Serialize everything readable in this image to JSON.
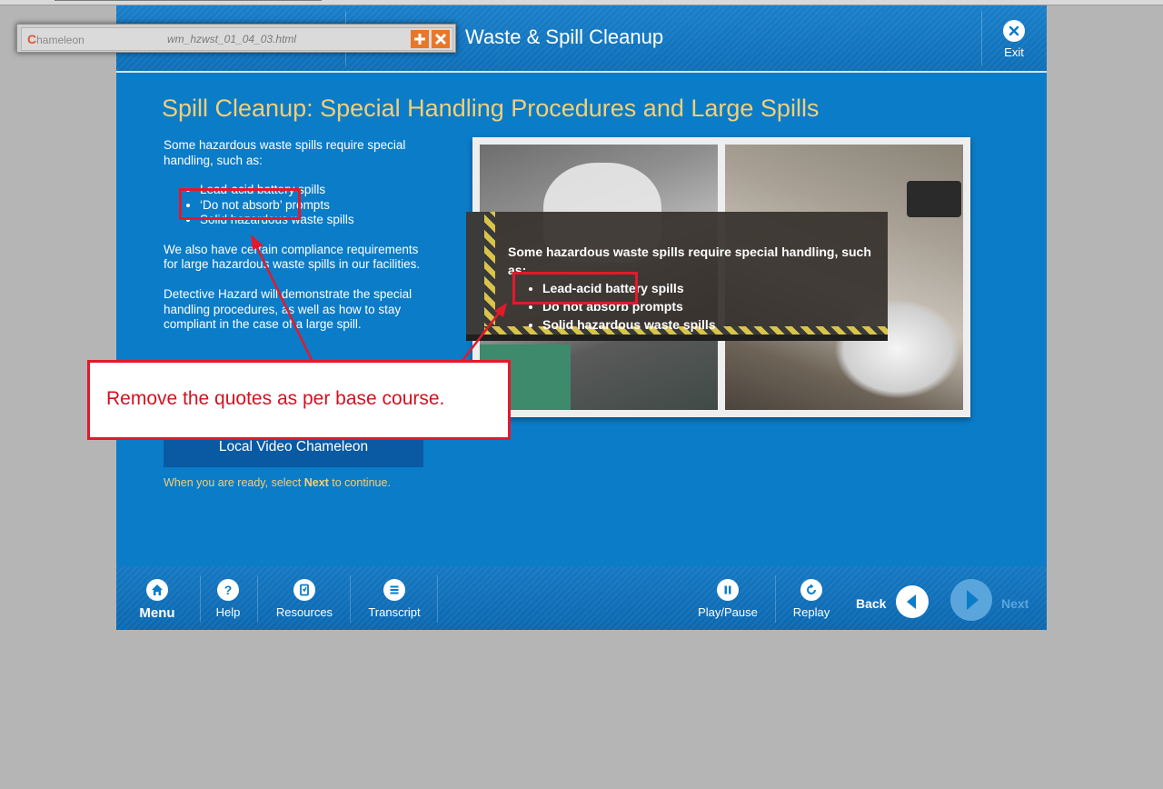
{
  "window": {
    "file_name": "wm_hzwst_01_04_03.html"
  },
  "chameleon": {
    "logo_text": "hameleon",
    "logo_c": "C"
  },
  "header": {
    "title": "Waste & Spill Cleanup",
    "exit_label": "Exit"
  },
  "slide": {
    "title": "Spill Cleanup:  Special Handling Procedures and Large Spills",
    "intro": "Some hazardous waste spills require special handling, such as:",
    "bullets": [
      "Lead-acid battery spills",
      "‘Do not absorb’ prompts",
      "Solid hazardous waste spills"
    ],
    "para2": "We also have certain compliance requirements for large hazardous waste spills in our facilities.",
    "para3": "Detective Hazard will demonstrate the special handling procedures, as well as how to stay compliant in the case of a large spill.",
    "video_button": "Local Video Chameleon",
    "ready_prefix": "When you are ready, select ",
    "ready_next": "Next",
    "ready_suffix": " to continue."
  },
  "overlay": {
    "intro": "Some hazardous waste spills require special handling, such as:",
    "bullets": [
      "Lead-acid battery spills",
      "Do not absorb prompts",
      "Solid hazardous waste spills"
    ]
  },
  "annotation": {
    "text": "Remove the quotes as per base course."
  },
  "footer": {
    "menu": "Menu",
    "help": "Help",
    "resources": "Resources",
    "transcript": "Transcript",
    "play_pause": "Play/Pause",
    "replay": "Replay",
    "back": "Back",
    "next": "Next"
  },
  "colors": {
    "course_blue": "#0b7cc8",
    "title_gold": "#f1cf77",
    "annotation_red": "#e3192b",
    "next_disabled": "#5aa6dc"
  }
}
